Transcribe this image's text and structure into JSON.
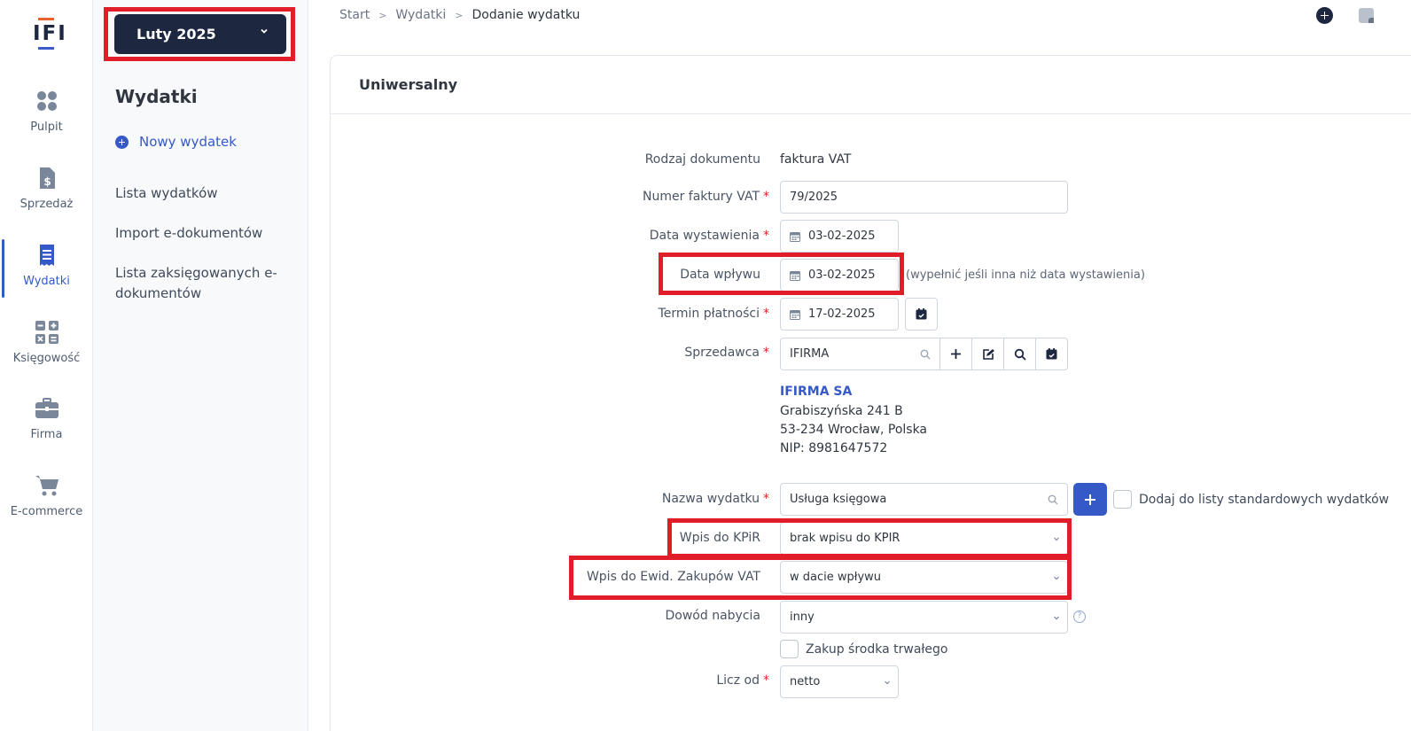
{
  "logo": {
    "text": "IFI"
  },
  "rail": {
    "items": [
      {
        "label": "Pulpit",
        "icon": "grid-icon"
      },
      {
        "label": "Sprzedaż",
        "icon": "invoice-icon"
      },
      {
        "label": "Wydatki",
        "icon": "receipt-icon",
        "active": true
      },
      {
        "label": "Księgowość",
        "icon": "calculator-icon"
      },
      {
        "label": "Firma",
        "icon": "briefcase-icon"
      },
      {
        "label": "E-commerce",
        "icon": "cart-icon"
      }
    ]
  },
  "period": {
    "label": "Luty 2025"
  },
  "submenu": {
    "title": "Wydatki",
    "new_label": "Nowy wydatek",
    "links": [
      "Lista wydatków",
      "Import e-dokumentów",
      "Lista zaksięgowanych e-dokumentów"
    ]
  },
  "breadcrumb": [
    "Start",
    "Wydatki",
    "Dodanie wydatku"
  ],
  "card": {
    "title": "Uniwersalny"
  },
  "form": {
    "doc_type_label": "Rodzaj dokumentu",
    "doc_type_value": "faktura VAT",
    "invoice_no_label": "Numer faktury VAT",
    "invoice_no_value": "79/2025",
    "issue_date_label": "Data wystawienia",
    "issue_date_value": "03-02-2025",
    "receipt_date_label": "Data wpływu",
    "receipt_date_value": "03-02-2025",
    "receipt_date_hint": "(wypełnić jeśli inna niż data wystawienia)",
    "due_date_label": "Termin płatności",
    "due_date_value": "17-02-2025",
    "seller_label": "Sprzedawca",
    "seller_value": "IFIRMA",
    "seller": {
      "name": "IFIRMA SA",
      "street": "Grabiszyńska 241 B",
      "city": "53-234 Wrocław, Polska",
      "nip": "NIP: 8981647572"
    },
    "expense_name_label": "Nazwa wydatku",
    "expense_name_value": "Usługa księgowa",
    "add_standard_label": "Dodaj do listy standardowych wydatków",
    "kpir_label": "Wpis do KPiR",
    "kpir_value": "brak wpisu do KPIR",
    "vat_label": "Wpis do Ewid. Zakupów VAT",
    "vat_value": "w dacie wpływu",
    "proof_label": "Dowód nabycia",
    "proof_value": "inny",
    "fixed_asset_label": "Zakup środka trwałego",
    "calc_label": "Licz od",
    "calc_value": "netto",
    "required_mark": "*",
    "help_mark": "?"
  },
  "colors": {
    "highlight": "#e11d2a",
    "accent": "#3559c7",
    "dark": "#1e2740"
  }
}
